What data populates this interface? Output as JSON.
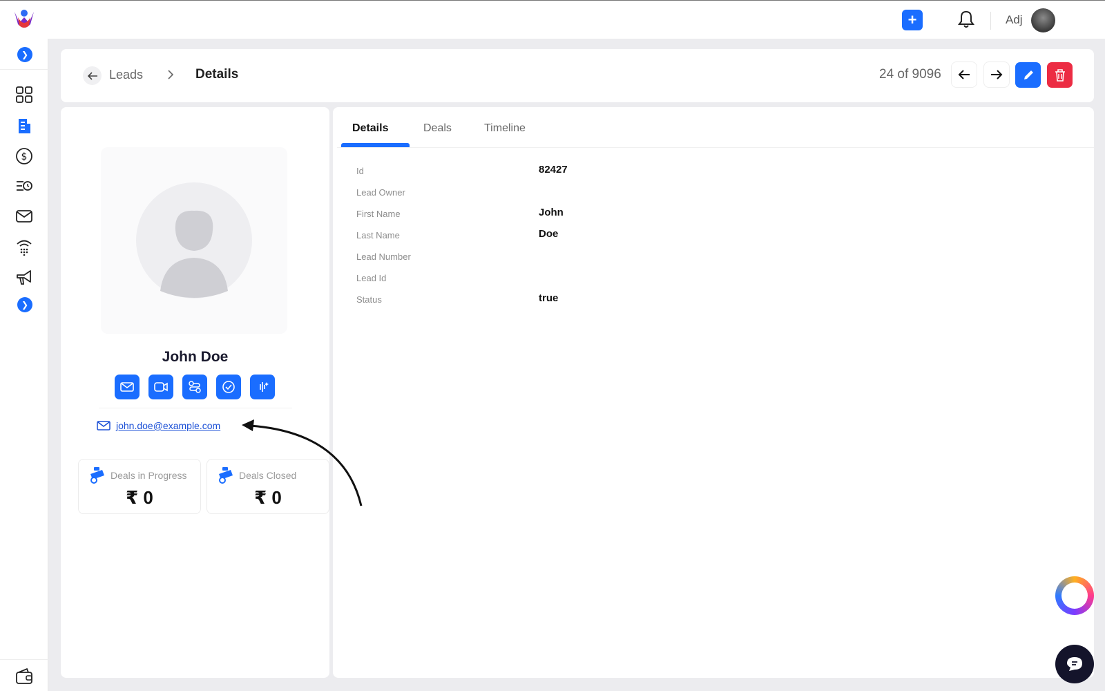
{
  "topbar": {
    "user_name": "Adj",
    "icons": [
      "app-logo",
      "add-icon",
      "bell-icon",
      "avatar"
    ]
  },
  "sidebar": {
    "items": [
      "grid-icon",
      "building-icon",
      "dollar-icon",
      "list-clock-icon",
      "mail-icon",
      "phone-signal-icon",
      "megaphone-icon"
    ],
    "toggle_icon": "chevron-right-icon",
    "more_icon": "chevron-down-icon",
    "bottom_icon": "wallet-icon"
  },
  "header": {
    "breadcrumb_parent": "Leads",
    "breadcrumb_current": "Details",
    "pager": "24 of 9096"
  },
  "profile": {
    "name": "John Doe",
    "email": "john.doe@example.com",
    "actions": [
      "mail-icon",
      "video-icon",
      "route-icon",
      "badge-icon",
      "sparkle-icon"
    ],
    "stats": [
      {
        "label": "Deals in Progress",
        "value": "₹ 0"
      },
      {
        "label": "Deals Closed",
        "value": "₹ 0"
      }
    ]
  },
  "tabs": [
    "Details",
    "Deals",
    "Timeline"
  ],
  "active_tab": "Details",
  "fields": [
    {
      "label": "Id",
      "value": "82427"
    },
    {
      "label": "Lead Owner",
      "value": ""
    },
    {
      "label": "First Name",
      "value": "John"
    },
    {
      "label": "Last Name",
      "value": "Doe"
    },
    {
      "label": "Lead Number",
      "value": ""
    },
    {
      "label": "Lead Id",
      "value": ""
    },
    {
      "label": "Status",
      "value": "true"
    }
  ],
  "colors": {
    "primary": "#1a6dff",
    "danger": "#ec2c43",
    "chat": "#14142b"
  }
}
